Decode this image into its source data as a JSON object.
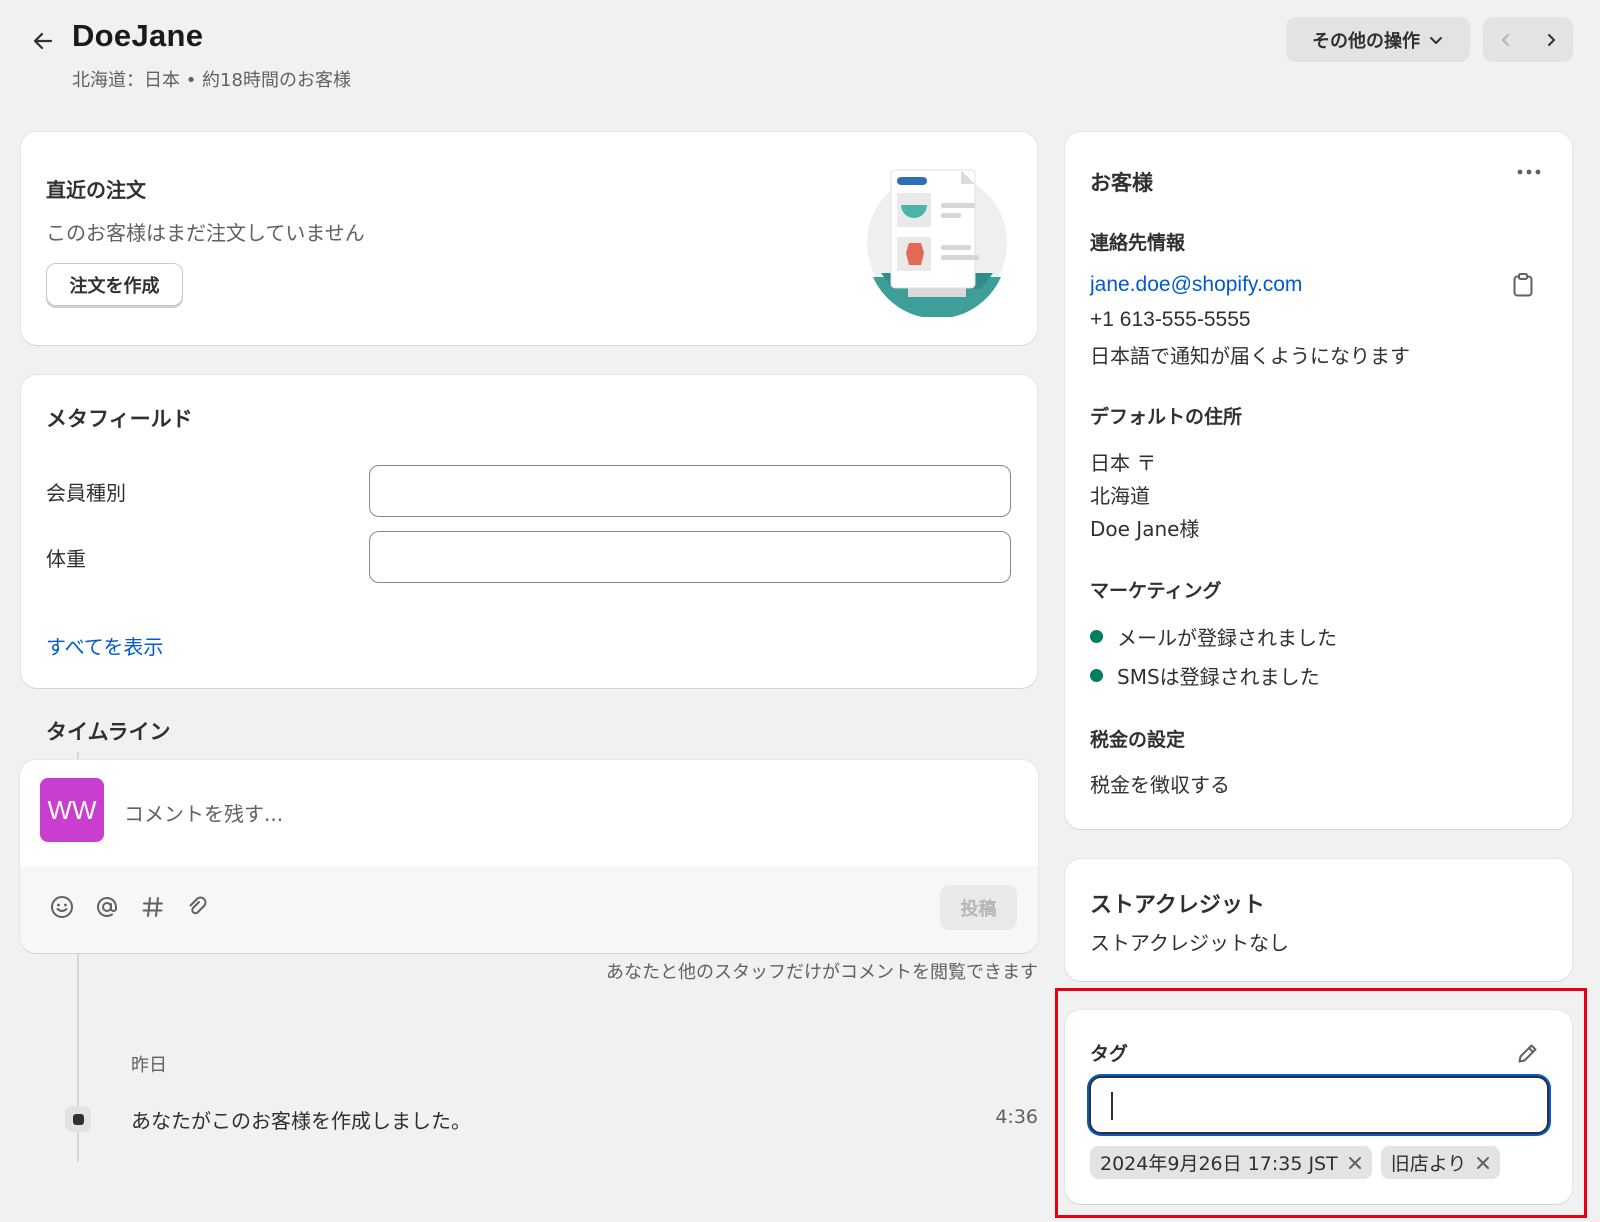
{
  "header": {
    "title": "DoeJane",
    "subtitle": "北海道：日本 • 約18時間のお客様",
    "more_actions_label": "その他の操作"
  },
  "recent_orders": {
    "title": "直近の注文",
    "empty_text": "このお客様はまだ注文していません",
    "create_order_label": "注文を作成"
  },
  "metafields": {
    "title": "メタフィールド",
    "fields": [
      {
        "label": "会員種別",
        "value": ""
      },
      {
        "label": "体重",
        "value": ""
      }
    ],
    "show_all_label": "すべてを表示"
  },
  "timeline": {
    "title": "タイムライン",
    "avatar_initials": "WW",
    "comment_placeholder": "コメントを残す...",
    "post_label": "投稿",
    "visibility_note": "あなたと他のスタッフだけがコメントを閲覧できます",
    "date_label": "昨日",
    "events": [
      {
        "text": "あなたがこのお客様を作成しました。",
        "time": "4:36"
      }
    ]
  },
  "customer": {
    "title": "お客様",
    "contact_title": "連絡先情報",
    "email": "jane.doe@shopify.com",
    "phone": "+1 613-555-5555",
    "notification_language": "日本語で通知が届くようになります",
    "address_title": "デフォルトの住所",
    "address_lines": [
      "日本 〒",
      "北海道",
      "Doe Jane様"
    ],
    "marketing_title": "マーケティング",
    "marketing_items": [
      "メールが登録されました",
      "SMSは登録されました"
    ],
    "tax_title": "税金の設定",
    "tax_value": "税金を徴収する"
  },
  "store_credit": {
    "title": "ストアクレジット",
    "value": "ストアクレジットなし"
  },
  "tags": {
    "title": "タグ",
    "input_value": "",
    "chips": [
      "2024年9月26日 17:35 JST",
      "旧店より"
    ]
  },
  "colors": {
    "accent_link": "#005bd3",
    "avatar_bg": "#c93ecf",
    "marketing_dot": "#007f5f",
    "highlight_border": "#e60012"
  }
}
